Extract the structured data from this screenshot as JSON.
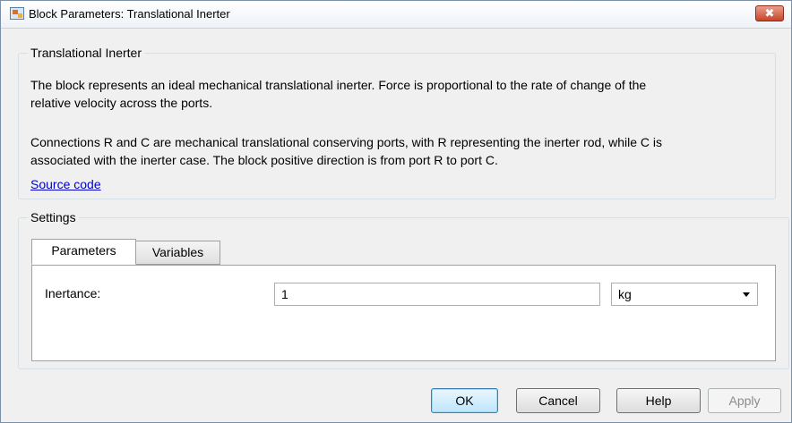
{
  "window": {
    "title": "Block Parameters: Translational Inerter",
    "close_glyph": "✖",
    "app_icon": "simulink-block-icon",
    "close_icon": "close-icon"
  },
  "description": {
    "group_title": "Translational Inerter",
    "line1": "The block represents an ideal mechanical translational inerter. Force is proportional to the rate of change of the",
    "line2": "relative velocity across the ports.",
    "line3": "Connections R and C are mechanical translational conserving ports, with R representing the inerter rod, while C is",
    "line4": "associated with the inerter case. The block positive direction is from port R to port C.",
    "source_link": "Source code"
  },
  "settings": {
    "group_title": "Settings",
    "tabs": [
      {
        "label": "Parameters",
        "active": true
      },
      {
        "label": "Variables",
        "active": false
      }
    ],
    "parameters": [
      {
        "label": "Inertance:",
        "value": "1",
        "unit": "kg"
      }
    ]
  },
  "buttons": {
    "ok": "OK",
    "cancel": "Cancel",
    "help": "Help",
    "apply": "Apply"
  },
  "colors": {
    "close_button": "#c7452a",
    "link": "#0000cc",
    "default_button_border": "#3c7fb1"
  }
}
